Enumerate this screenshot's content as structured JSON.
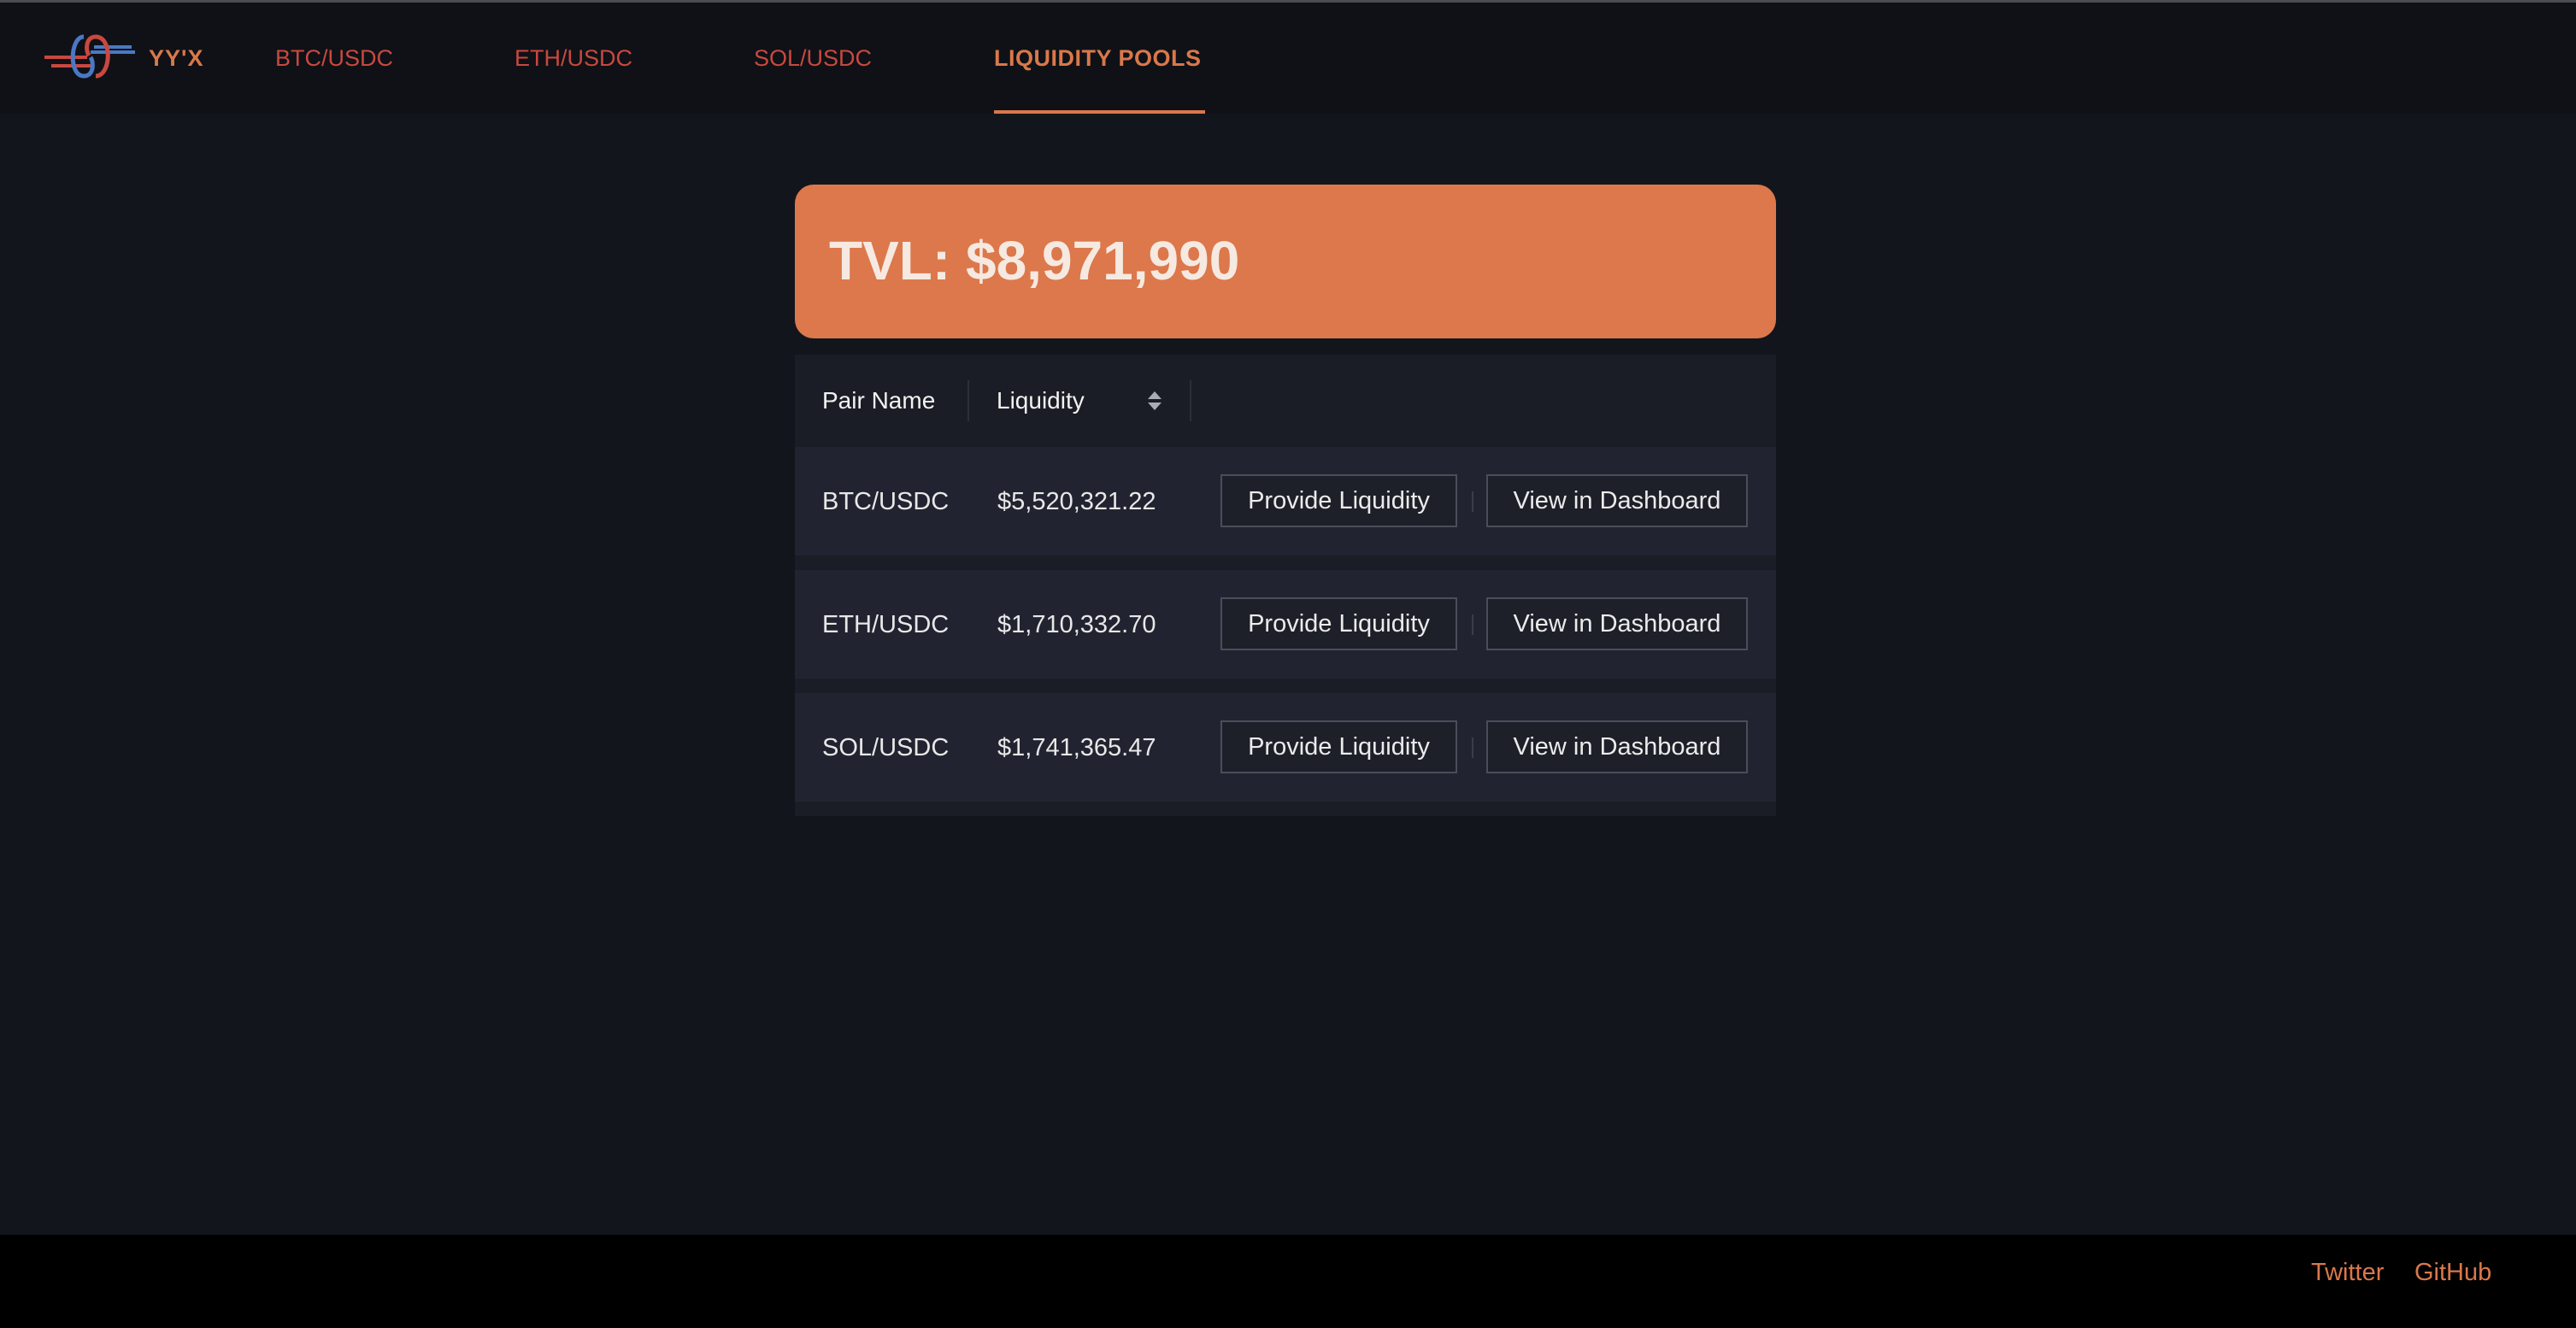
{
  "app": {
    "brand": "YY'X",
    "logo_icon": "knot-logo-icon"
  },
  "nav": {
    "items": [
      {
        "label": "BTC/USDC",
        "active": false
      },
      {
        "label": "ETH/USDC",
        "active": false
      },
      {
        "label": "SOL/USDC",
        "active": false
      },
      {
        "label": "LIQUIDITY POOLS",
        "active": true
      }
    ]
  },
  "tvl": {
    "text": "TVL: $8,971,990"
  },
  "table": {
    "headers": {
      "pair_name": "Pair Name",
      "liquidity": "Liquidity"
    },
    "sort_icon": "sort-updown-icon",
    "rows": [
      {
        "pair": "BTC/USDC",
        "liquidity": "$5,520,321.22",
        "provide_label": "Provide Liquidity",
        "view_label": "View in Dashboard"
      },
      {
        "pair": "ETH/USDC",
        "liquidity": "$1,710,332.70",
        "provide_label": "Provide Liquidity",
        "view_label": "View in Dashboard"
      },
      {
        "pair": "SOL/USDC",
        "liquidity": "$1,741,365.47",
        "provide_label": "Provide Liquidity",
        "view_label": "View in Dashboard"
      }
    ]
  },
  "footer": {
    "links": [
      {
        "label": "Twitter"
      },
      {
        "label": "GitHub"
      }
    ]
  },
  "colors": {
    "background": "#13151d",
    "header": "#0f1116",
    "accent": "#dc784b",
    "nav_link": "#c9483f",
    "logo_red": "#c9483f",
    "logo_blue": "#4a78c4"
  }
}
